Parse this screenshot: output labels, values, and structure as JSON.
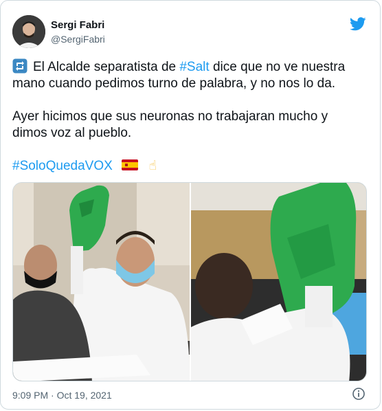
{
  "author": {
    "name": "Sergi Fabri",
    "handle": "@SergiFabri"
  },
  "tweet": {
    "line1_pre": "El Alcalde separatista de ",
    "line1_hashtag": "#Salt",
    "line1_post": " dice que no ve nuestra",
    "line2": "mano cuando pedimos turno de palabra, y no nos lo da.",
    "line3": "Ayer hicimos que sus neuronas no trabajaran mucho y",
    "line4": "dimos voz al pueblo.",
    "hashtag": "#SoloQuedaVOX",
    "emoji_finger": "☝"
  },
  "timestamp": "9:09 PM · Oct 19, 2021",
  "icons": {
    "brand": "twitter-bird-icon",
    "retweet": "retweet-icon",
    "flag": "spain-flag-icon",
    "info": "info-icon"
  },
  "colors": {
    "link": "#1d9bf0",
    "text": "#0f1419",
    "secondary": "#536471",
    "border": "#cfd9de"
  }
}
